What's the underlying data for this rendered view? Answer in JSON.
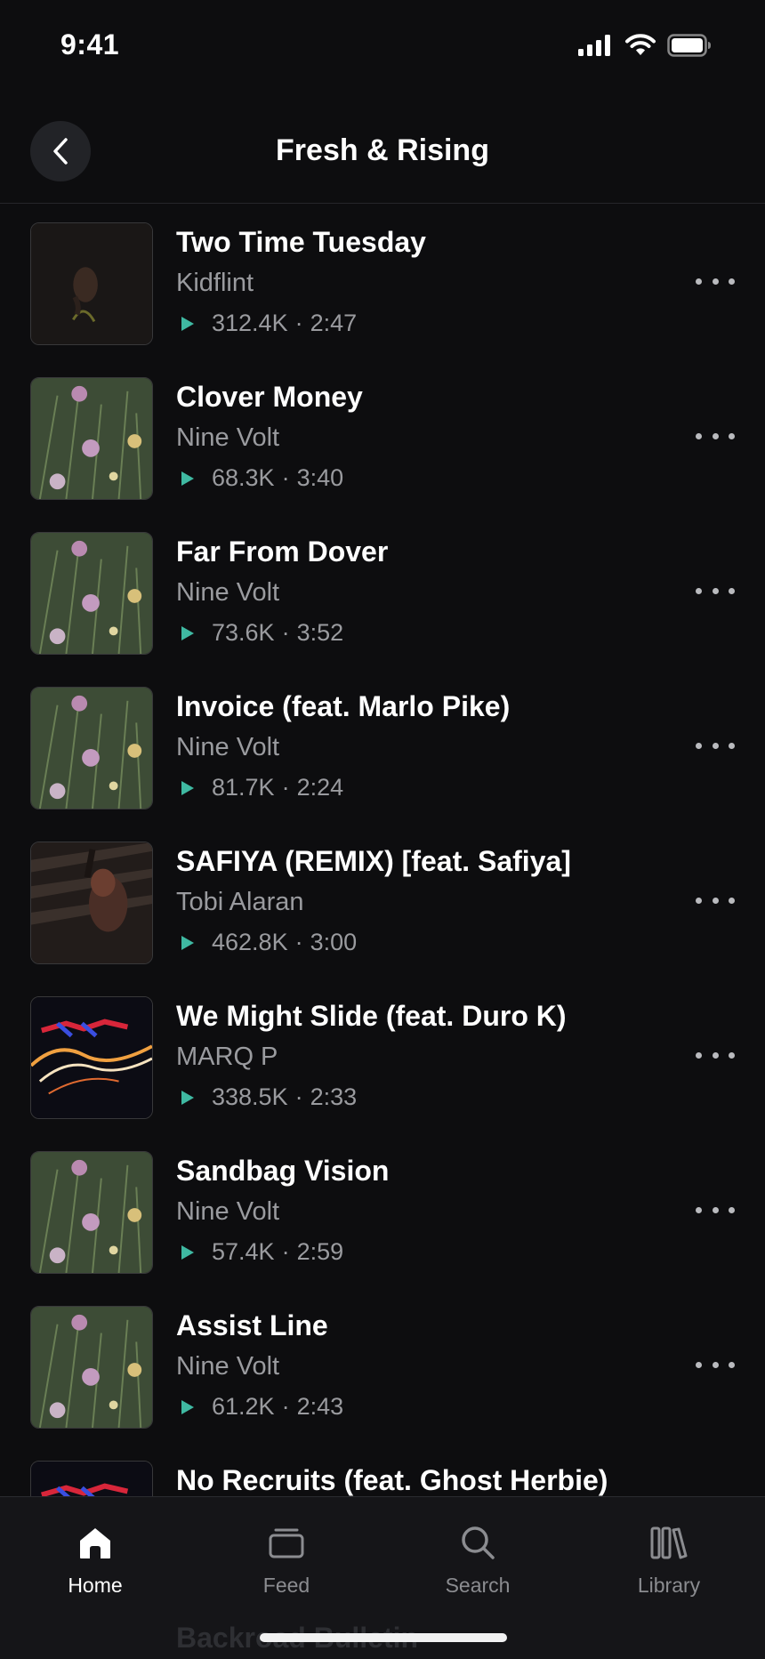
{
  "status_bar": {
    "time": "9:41"
  },
  "header": {
    "title": "Fresh & Rising"
  },
  "tracks": [
    {
      "title": "Two Time Tuesday",
      "artist": "Kidflint",
      "plays": "312.4K",
      "duration": "2:47",
      "art": "portrait-dark"
    },
    {
      "title": "Clover Money",
      "artist": "Nine Volt",
      "plays": "68.3K",
      "duration": "3:40",
      "art": "flowers"
    },
    {
      "title": "Far From Dover",
      "artist": "Nine Volt",
      "plays": "73.6K",
      "duration": "3:52",
      "art": "flowers"
    },
    {
      "title": "Invoice (feat. Marlo Pike)",
      "artist": "Nine Volt",
      "plays": "81.7K",
      "duration": "2:24",
      "art": "flowers"
    },
    {
      "title": "SAFIYA (REMIX) [feat. Safiya]",
      "artist": "Tobi Alaran",
      "plays": "462.8K",
      "duration": "3:00",
      "art": "portrait-shadow"
    },
    {
      "title": "We Might Slide (feat. Duro K)",
      "artist": "MARQ P",
      "plays": "338.5K",
      "duration": "2:33",
      "art": "light-trails"
    },
    {
      "title": "Sandbag Vision",
      "artist": "Nine Volt",
      "plays": "57.4K",
      "duration": "2:59",
      "art": "flowers"
    },
    {
      "title": "Assist Line",
      "artist": "Nine Volt",
      "plays": "61.2K",
      "duration": "2:43",
      "art": "flowers"
    },
    {
      "title": "No Recruits (feat. Ghost Herbie)",
      "artist": "",
      "plays": "",
      "duration": "",
      "art": "light-trails"
    }
  ],
  "peek_title": "Backroad Bulletin",
  "tabs": [
    {
      "label": "Home",
      "icon": "home-icon",
      "active": true
    },
    {
      "label": "Feed",
      "icon": "feed-icon",
      "active": false
    },
    {
      "label": "Search",
      "icon": "search-icon",
      "active": false
    },
    {
      "label": "Library",
      "icon": "library-icon",
      "active": false
    }
  ],
  "colors": {
    "accent": "#3fb9a2",
    "background": "#0d0d0f",
    "secondary_text": "#9a9b9f"
  }
}
